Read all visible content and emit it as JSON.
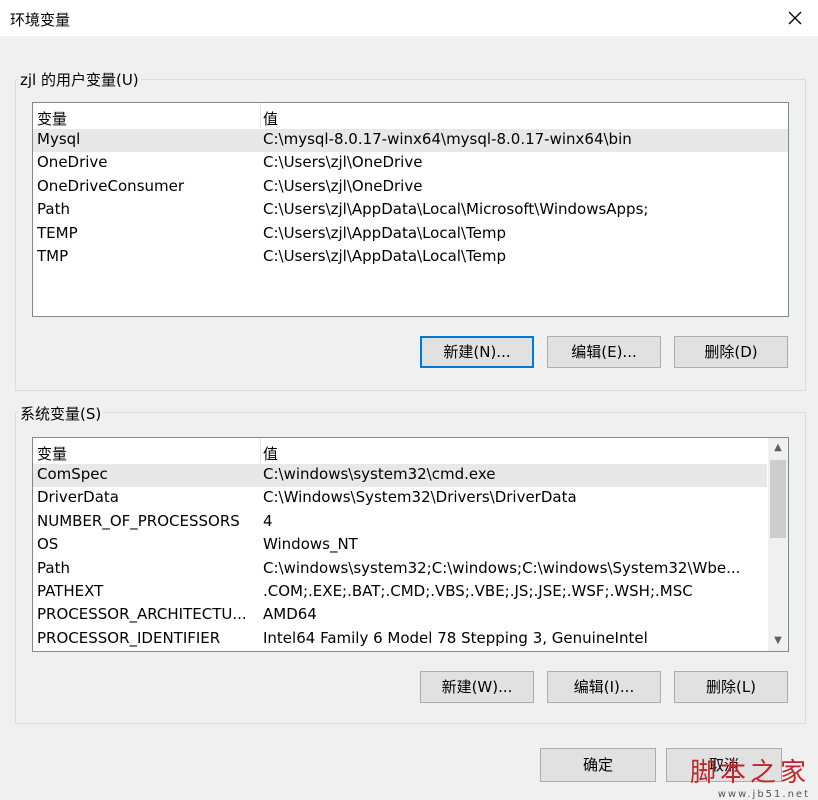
{
  "window": {
    "title": "环境变量",
    "close_icon": "close-icon"
  },
  "user_vars": {
    "label": "zjl 的用户变量(U)",
    "header": {
      "name": "变量",
      "value": "值"
    },
    "rows": [
      {
        "name": "Mysql",
        "value": "C:\\mysql-8.0.17-winx64\\mysql-8.0.17-winx64\\bin"
      },
      {
        "name": "OneDrive",
        "value": "C:\\Users\\zjl\\OneDrive"
      },
      {
        "name": "OneDriveConsumer",
        "value": "C:\\Users\\zjl\\OneDrive"
      },
      {
        "name": "Path",
        "value": "C:\\Users\\zjl\\AppData\\Local\\Microsoft\\WindowsApps;"
      },
      {
        "name": "TEMP",
        "value": "C:\\Users\\zjl\\AppData\\Local\\Temp"
      },
      {
        "name": "TMP",
        "value": "C:\\Users\\zjl\\AppData\\Local\\Temp"
      }
    ],
    "buttons": {
      "new": "新建(N)...",
      "edit": "编辑(E)...",
      "delete": "删除(D)"
    }
  },
  "system_vars": {
    "label": "系统变量(S)",
    "header": {
      "name": "变量",
      "value": "值"
    },
    "rows": [
      {
        "name": "ComSpec",
        "value": "C:\\windows\\system32\\cmd.exe"
      },
      {
        "name": "DriverData",
        "value": "C:\\Windows\\System32\\Drivers\\DriverData"
      },
      {
        "name": "NUMBER_OF_PROCESSORS",
        "value": "4"
      },
      {
        "name": "OS",
        "value": "Windows_NT"
      },
      {
        "name": "Path",
        "value": "C:\\windows\\system32;C:\\windows;C:\\windows\\System32\\Wbe..."
      },
      {
        "name": "PATHEXT",
        "value": ".COM;.EXE;.BAT;.CMD;.VBS;.VBE;.JS;.JSE;.WSF;.WSH;.MSC"
      },
      {
        "name": "PROCESSOR_ARCHITECTU...",
        "value": "AMD64"
      },
      {
        "name": "PROCESSOR_IDENTIFIER",
        "value": "Intel64 Family 6 Model 78 Stepping 3, GenuineIntel"
      }
    ],
    "buttons": {
      "new": "新建(W)...",
      "edit": "编辑(I)...",
      "delete": "删除(L)"
    }
  },
  "footer": {
    "ok": "确定",
    "cancel": "取消"
  },
  "watermark": {
    "line1": "脚本之家",
    "line2": "www.jb51.net"
  }
}
